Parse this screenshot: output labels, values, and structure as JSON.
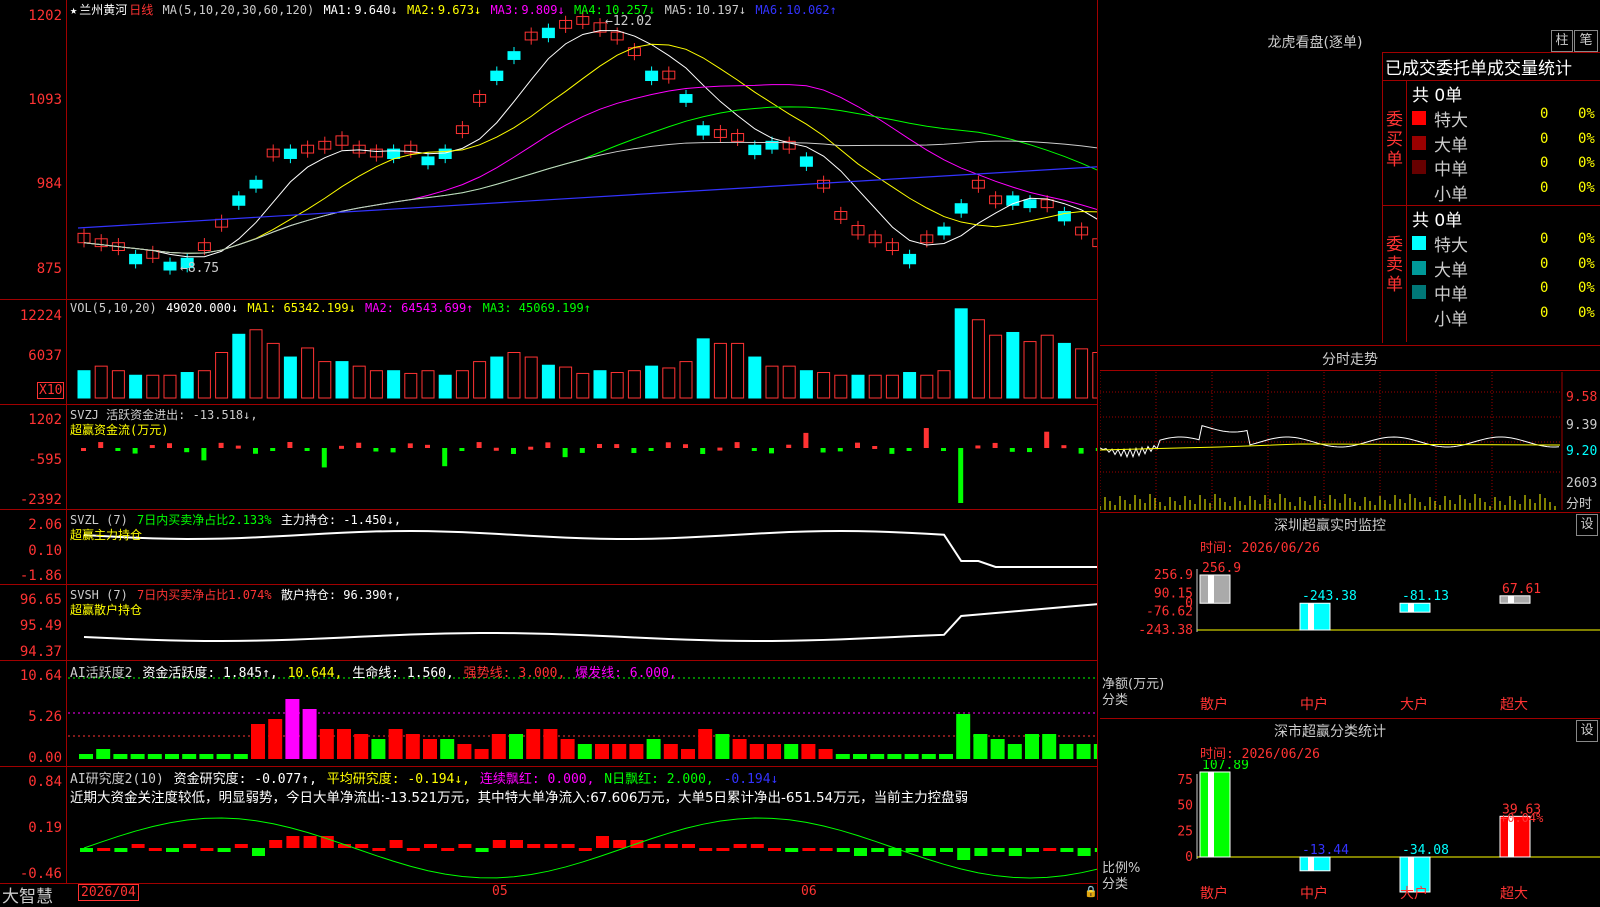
{
  "stock": {
    "star": "★",
    "name": "兰州黄河",
    "period": "日线"
  },
  "k_header": {
    "ma_label": "MA(5,10,20,30,60,120)",
    "ma1": {
      "label": "MA1:",
      "value": "9.640↓",
      "color": "#ffffff"
    },
    "ma2": {
      "label": "MA2:",
      "value": "9.673↓",
      "color": "#ffff00"
    },
    "ma3": {
      "label": "MA3:",
      "value": "9.809↓",
      "color": "#ff00ff"
    },
    "ma4": {
      "label": "MA4:",
      "value": "10.257↓",
      "color": "#00ff00"
    },
    "ma5": {
      "label": "MA5:",
      "value": "10.197↓",
      "color": "#cccccc"
    },
    "ma6": {
      "label": "MA6:",
      "value": "10.062↑",
      "color": "#3333ff"
    }
  },
  "k_axis": [
    "1202",
    "1093",
    "984",
    "875"
  ],
  "k_annotations": {
    "high": "12.02",
    "low": "8.75"
  },
  "vol_header": {
    "label": "VOL(5,10,20)",
    "value": "49020.000↓",
    "ma1": "MA1: 65342.199↓",
    "ma2": "MA2: 64543.699↑",
    "ma3": "MA3: 45069.199↑"
  },
  "vol_axis": [
    "12224",
    "6037"
  ],
  "vol_unit": "X10",
  "svzj": {
    "line1": "SVZJ  活跃资金进出: -13.518↓,",
    "line2": "超赢资金流(万元)",
    "axis": [
      "1202",
      "-595",
      "-2392"
    ]
  },
  "svzl": {
    "name": "SVZL (7)",
    "ratio": "7日内买卖净占比2.133%",
    "hold": "主力持仓: -1.450↓,",
    "line2": "超赢主力持仓",
    "axis": [
      "2.06",
      "0.10",
      "-1.86"
    ]
  },
  "svsh": {
    "name": "SVSH (7)",
    "ratio": "7日内买卖净占比1.074%",
    "hold": "散户持仓: 96.390↑,",
    "line2": "超赢散户持仓",
    "axis": [
      "96.65",
      "95.49",
      "94.37"
    ]
  },
  "ai1": {
    "name": "AI活跃度2",
    "a": "资金活跃度: 1.845↑,",
    "b": "10.644,",
    "c": "生命线: 1.560,",
    "d": "强势线: 3.000,",
    "e": "爆发线: 6.000,",
    "axis": [
      "10.64",
      "5.26",
      "0.00"
    ]
  },
  "ai2": {
    "name": "AI研究度2(10)",
    "a": "资金研究度: -0.077↑,",
    "b": "平均研究度: -0.194↓,",
    "c": "连续飘红: 0.000,",
    "d": "N日飘红: 2.000,",
    "e": "-0.194↓",
    "text": "近期大资金关注度较低，明显弱势，今日大单净流出:-13.521万元，其中特大单净流入:67.606万元，大单5日累计净出-651.54万元，当前主力控盘弱",
    "axis": [
      "0.84",
      "0.19",
      "-0.46"
    ]
  },
  "bottom": {
    "brand": "大智慧",
    "date": "2026/04",
    "m1": "05",
    "m2": "06"
  },
  "right": {
    "title": "龙虎看盘(逐单)",
    "btn1": "柱",
    "btn2": "笔",
    "table_title": "已成交委托单成交量统计",
    "buy_label": "委买单",
    "sell_label": "委卖单",
    "buy_total": "共 0单",
    "sell_total": "共 0单",
    "buy_rows": [
      {
        "label": "特大",
        "v1": "0",
        "v2": "0%",
        "color": "#ff0000"
      },
      {
        "label": "大单",
        "v1": "0",
        "v2": "0%",
        "color": "#990000"
      },
      {
        "label": "中单",
        "v1": "0",
        "v2": "0%",
        "color": "#660000"
      },
      {
        "label": "小单",
        "v1": "0",
        "v2": "0%",
        "color": "#000000"
      }
    ],
    "sell_rows": [
      {
        "label": "特大",
        "v1": "0",
        "v2": "0%",
        "color": "#00ffff"
      },
      {
        "label": "大单",
        "v1": "0",
        "v2": "0%",
        "color": "#009999"
      },
      {
        "label": "中单",
        "v1": "0",
        "v2": "0%",
        "color": "#007777"
      },
      {
        "label": "小单",
        "v1": "0",
        "v2": "0%",
        "color": "#000000"
      }
    ],
    "intraday_title": "分时走势",
    "intraday_axis": [
      "9.58",
      "9.39",
      "9.20"
    ],
    "intraday_vol": "2603",
    "intraday_unit": "分时",
    "monitor_title": "深圳超赢实时监控",
    "set1": "设",
    "monitor_time": "时间: 2026/06/26",
    "monitor_axis": [
      "256.9",
      "90.15",
      "0",
      "-76.62",
      "-243.38"
    ],
    "monitor_ylabel": "净额(万元)",
    "monitor_xlabel": "分类",
    "classify_title": "深市超赢分类统计",
    "set2": "设",
    "classify_time": "时间: 2026/06/26",
    "classify_axis": [
      "75",
      "50",
      "25",
      "0"
    ],
    "classify_ylabel": "比例%",
    "classify_xlabel": "分类"
  },
  "chart_data": [
    {
      "type": "bar",
      "title": "深圳超赢实时监控",
      "categories": [
        "散户",
        "中户",
        "大户",
        "超大"
      ],
      "values": [
        256.9,
        -243.38,
        -81.13,
        67.61
      ],
      "value_labels": [
        "256.9",
        "-243.38",
        "-81.13",
        "67.61"
      ],
      "ylim": [
        -243.38,
        256.9
      ]
    },
    {
      "type": "bar",
      "title": "深市超赢分类统计",
      "categories": [
        "散户",
        "中户",
        "大户",
        "超大"
      ],
      "values": [
        107.89,
        -13.44,
        -34.08,
        39.63
      ],
      "value_labels": [
        "107.89",
        "-13.44",
        "-34.08",
        "39.63"
      ],
      "note": "+0.04%",
      "ylim": [
        0,
        75
      ]
    }
  ]
}
